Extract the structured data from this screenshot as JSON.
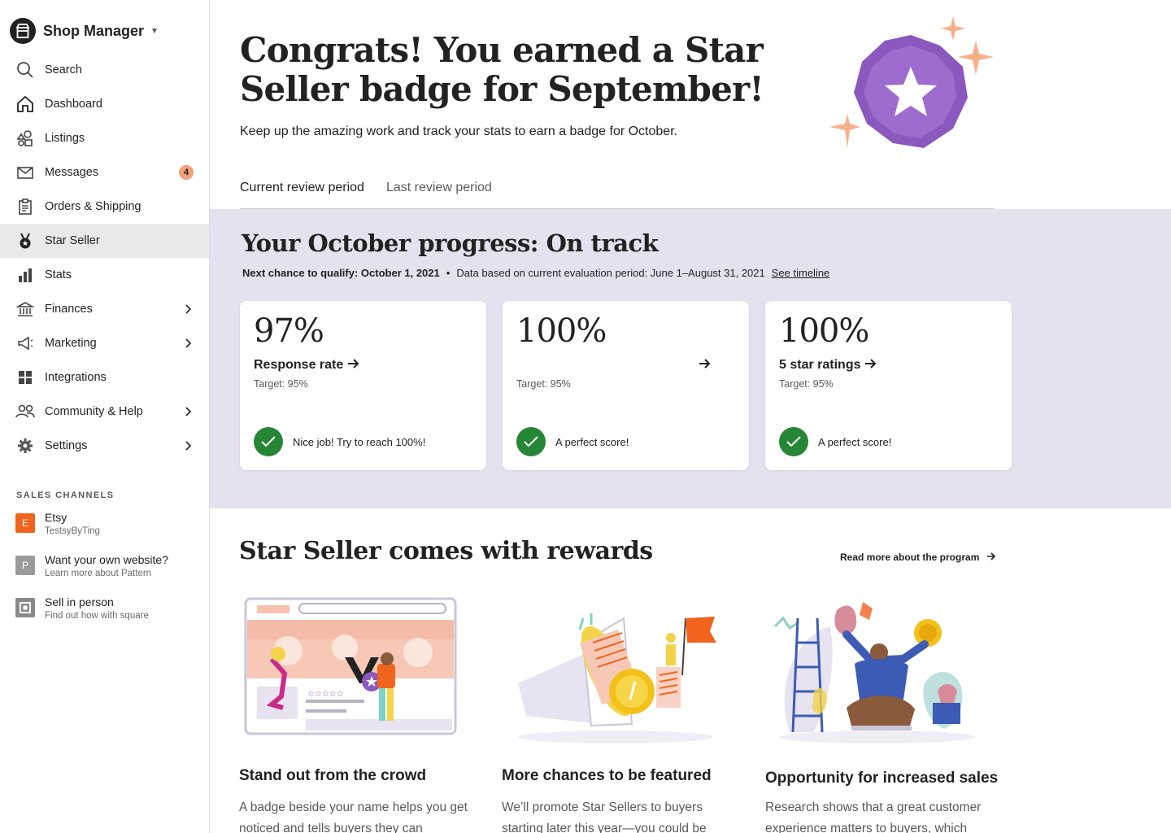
{
  "sidebar": {
    "brand_title": "Shop Manager",
    "nav": [
      {
        "label": "Search",
        "icon": "search-icon"
      },
      {
        "label": "Dashboard",
        "icon": "home-icon"
      },
      {
        "label": "Listings",
        "icon": "listings-icon"
      },
      {
        "label": "Messages",
        "icon": "mail-icon",
        "badge": "4"
      },
      {
        "label": "Orders & Shipping",
        "icon": "clipboard-icon"
      },
      {
        "label": "Star Seller",
        "icon": "medal-icon",
        "active": true
      },
      {
        "label": "Stats",
        "icon": "bar-chart-icon"
      },
      {
        "label": "Finances",
        "icon": "bank-icon",
        "chevron": true
      },
      {
        "label": "Marketing",
        "icon": "megaphone-icon",
        "chevron": true
      },
      {
        "label": "Integrations",
        "icon": "grid-icon"
      },
      {
        "label": "Community & Help",
        "icon": "people-icon",
        "chevron": true
      },
      {
        "label": "Settings",
        "icon": "gear-icon",
        "chevron": true
      }
    ],
    "channels_heading": "SALES CHANNELS",
    "channels": [
      {
        "letter": "E",
        "title": "Etsy",
        "subtitle": "TestsyByTing",
        "color": "#f1641e"
      },
      {
        "letter": "P",
        "title": "Want your own website?",
        "subtitle": "Learn more about Pattern",
        "color": "#9a9a9a"
      },
      {
        "letter": "",
        "title": "Sell in person",
        "subtitle": "Find out how with square",
        "color": "#8a8a8a"
      }
    ]
  },
  "hero": {
    "title": "Congrats! You earned a Star Seller badge for September!",
    "subtitle": "Keep up the amazing work and track your stats to earn a badge for October."
  },
  "tabs": [
    "Current review period",
    "Last review period"
  ],
  "progress": {
    "title": "Your October progress: On track",
    "qualify": "Next chance to qualify: October 1, 2021",
    "separator": "•",
    "data_note": "Data based on current evaluation period: June 1–August 31, 2021",
    "timeline_link": "See timeline",
    "cards": [
      {
        "percent": "97%",
        "label": "Response rate",
        "target": "Target: 95%",
        "status": "Nice job! Try to reach 100%!"
      },
      {
        "percent": "100%",
        "label": "",
        "target": "Target: 95%",
        "status": "A perfect score!"
      },
      {
        "percent": "100%",
        "label": "5 star ratings",
        "target": "Target: 95%",
        "status": "A perfect score!"
      }
    ]
  },
  "rewards": {
    "title": "Star Seller comes with rewards",
    "read_more": "Read more about the program",
    "items": [
      {
        "heading": "Stand out from the crowd",
        "text": "A badge beside your name helps you get noticed and tells buyers they can"
      },
      {
        "heading": "More chances to be featured",
        "text": "We’ll promote Star Sellers to buyers starting later this year—you could be"
      },
      {
        "heading": "Opportunity for increased sales",
        "text": "Research shows that a great customer experience matters to buyers, which"
      }
    ]
  },
  "colors": {
    "accent_purple": "#8c5cbf",
    "panel_lavender": "#e5e1ef",
    "success_green": "#258635",
    "etsy_orange": "#f1641e"
  }
}
